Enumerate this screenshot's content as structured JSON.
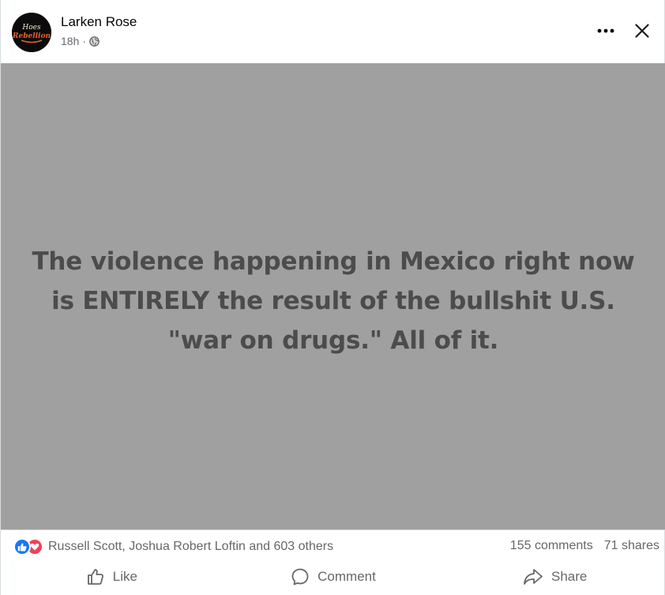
{
  "post": {
    "author": "Larken Rose",
    "time": "18h",
    "separator": "·",
    "privacy_icon": "globe-icon",
    "avatar_text": "Hoes Rebellion",
    "image_text": "The violence happening in Mexico right now is ENTIRELY the result of the bullshit U.S. \"war on drugs.\" All of it."
  },
  "header": {
    "more_icon": "more-options-icon",
    "close_icon": "close-icon"
  },
  "stats": {
    "reaction_icons": [
      "like-reaction-icon",
      "love-reaction-icon"
    ],
    "reaction_names": "Russell Scott, Joshua Robert Loftin and 603 others",
    "comments": "155 comments",
    "shares": "71 shares"
  },
  "actions": {
    "like": "Like",
    "comment": "Comment",
    "share": "Share"
  },
  "colors": {
    "image_background": "#a0a0a0",
    "image_text": "#4c4c4c",
    "like_blue": "#1877f2",
    "love_red": "#f33e58",
    "secondary_text": "#65676b"
  }
}
